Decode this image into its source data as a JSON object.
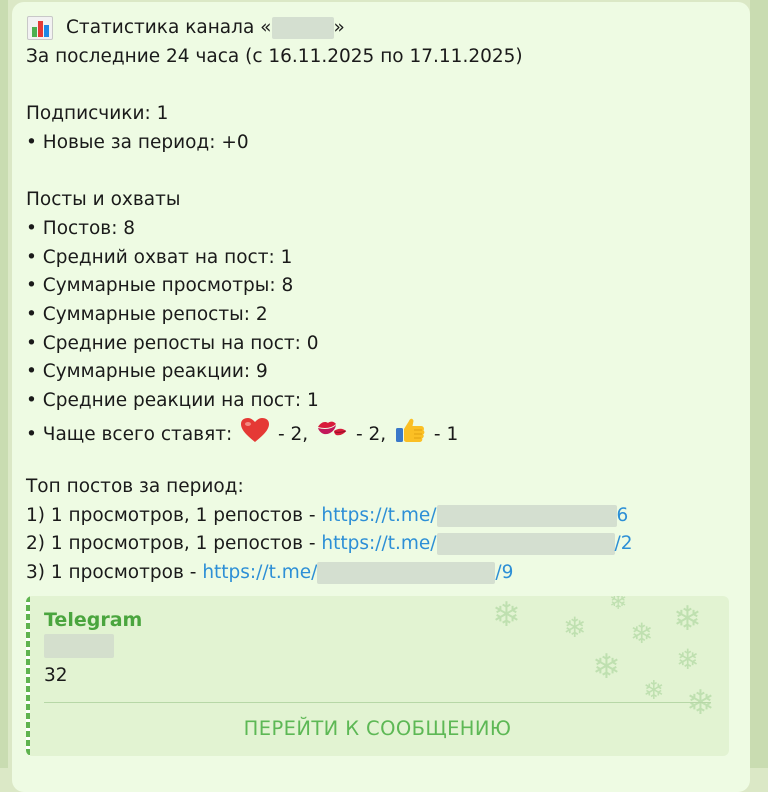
{
  "message": {
    "title_prefix": "Статистика канала «",
    "title_suffix": "»",
    "period": "За последние 24 часа (с 16.11.2025 по 17.11.2025)",
    "subscribers_heading": "Подписчики: 1",
    "new_subscribers": "• Новые за период: +0",
    "posts_heading": "Посты и охваты",
    "stats": [
      "• Постов: 8",
      "• Средний охват на пост: 1",
      "• Суммарные просмотры: 8",
      "• Суммарные репосты: 2",
      "• Средние репосты на пост: 0",
      "• Суммарные реакции: 9",
      "• Средние реакции на пост: 1"
    ],
    "reactions": {
      "label": "• Чаще всего ставят: ",
      "items": [
        {
          "icon": "red-heart-icon",
          "count": " - 2, "
        },
        {
          "icon": "kiss-icon",
          "count": " - 2, "
        },
        {
          "icon": "thumbs-up-icon",
          "count": " - 1"
        }
      ]
    },
    "top_heading": "Топ постов за период:",
    "top_posts": [
      {
        "text": "1) 1 просмотров, 1 репостов - ",
        "link_start": "https://t.me/",
        "link_end": "6"
      },
      {
        "text": "2) 1 просмотров, 1 репостов - ",
        "link_start": "https://t.me/",
        "link_end": "/2"
      },
      {
        "text": "3) 1 просмотров - ",
        "link_start": "https://t.me/",
        "link_end": "/9"
      }
    ]
  },
  "card": {
    "site": "Telegram",
    "count": "32",
    "button_label": "ПЕРЕЙТИ К СООБЩЕНИЮ"
  },
  "colors": {
    "bubble": "#eefbe3",
    "link": "#2d8fd6",
    "accent": "#4aa53e",
    "button": "#5db855"
  }
}
